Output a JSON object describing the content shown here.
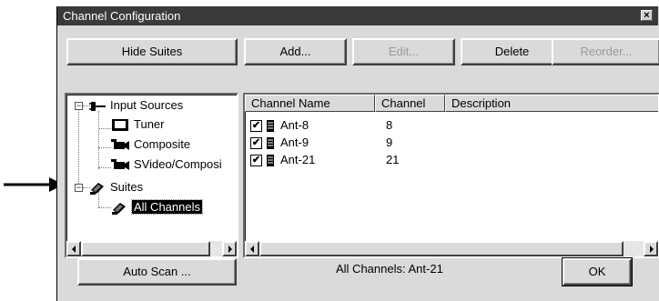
{
  "dialog": {
    "title": "Channel Configuration",
    "close_glyph": "×"
  },
  "buttons": {
    "hide_suites": "Hide Suites",
    "add": "Add...",
    "edit": "Edit...",
    "delete": "Delete",
    "reorder": "Reorder...",
    "auto_scan": "Auto Scan ...",
    "ok": "OK"
  },
  "tree": {
    "input_sources": {
      "label": "Input Sources",
      "icon": "plug-icon"
    },
    "tuner": {
      "label": "Tuner",
      "icon": "monitor-icon"
    },
    "composite": {
      "label": "Composite",
      "icon": "camera-icon"
    },
    "svideo": {
      "label": "SVideo/Composi",
      "icon": "camera-icon"
    },
    "suites": {
      "label": "Suites",
      "icon": "suite-icon"
    },
    "all_channels": {
      "label": "All Channels",
      "icon": "suite-icon"
    }
  },
  "table": {
    "columns": [
      "Channel Name",
      "Channel",
      "Description"
    ],
    "rows": [
      {
        "name": "Ant-8",
        "channel": "8",
        "description": "",
        "checked": true
      },
      {
        "name": "Ant-9",
        "channel": "9",
        "description": "",
        "checked": true
      },
      {
        "name": "Ant-21",
        "channel": "21",
        "description": "",
        "checked": true
      }
    ]
  },
  "status": {
    "text": "All Channels:  Ant-21"
  }
}
